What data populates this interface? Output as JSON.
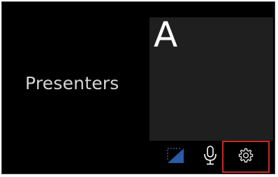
{
  "presenters_panel": {
    "label": "Presenters"
  },
  "video_tile": {
    "initial": "A"
  },
  "controls": {
    "items": [
      {
        "icon": "screen-share-icon"
      },
      {
        "icon": "microphone-icon"
      },
      {
        "icon": "gear-icon",
        "highlighted": true
      }
    ]
  },
  "colors": {
    "background": "#000000",
    "tile_background": "#1f1f1f",
    "accent_blue": "#2a5aa8",
    "highlight_red": "#c62828"
  }
}
